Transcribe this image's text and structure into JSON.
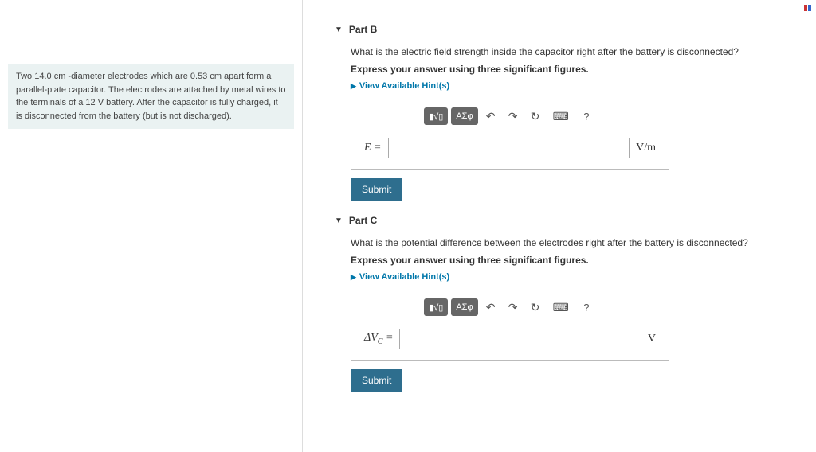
{
  "problem": {
    "text": "Two 14.0 cm -diameter electrodes which are 0.53 cm apart form a parallel-plate capacitor. The electrodes are attached by metal wires to the terminals of a 12 V battery. After the capacitor is fully charged, it is disconnected from the battery (but is not discharged)."
  },
  "partB": {
    "title": "Part B",
    "question": "What is the electric field strength inside the capacitor right after the battery is disconnected?",
    "express": "Express your answer using three significant figures.",
    "hints": "View Available Hint(s)",
    "variable": "E =",
    "unit": "V/m",
    "submit": "Submit"
  },
  "partC": {
    "title": "Part C",
    "question": "What is the potential difference between the electrodes right after the battery is disconnected?",
    "express": "Express your answer using three significant figures.",
    "hints": "View Available Hint(s)",
    "variable_prefix": "ΔV",
    "variable_sub": "C",
    "variable_suffix": " =",
    "unit": "V",
    "submit": "Submit"
  },
  "toolbar": {
    "templates": "▮√▯",
    "symbols": "ΑΣφ",
    "undo": "↶",
    "redo": "↷",
    "reset": "↻",
    "keyboard": "⌨",
    "help": "?"
  }
}
